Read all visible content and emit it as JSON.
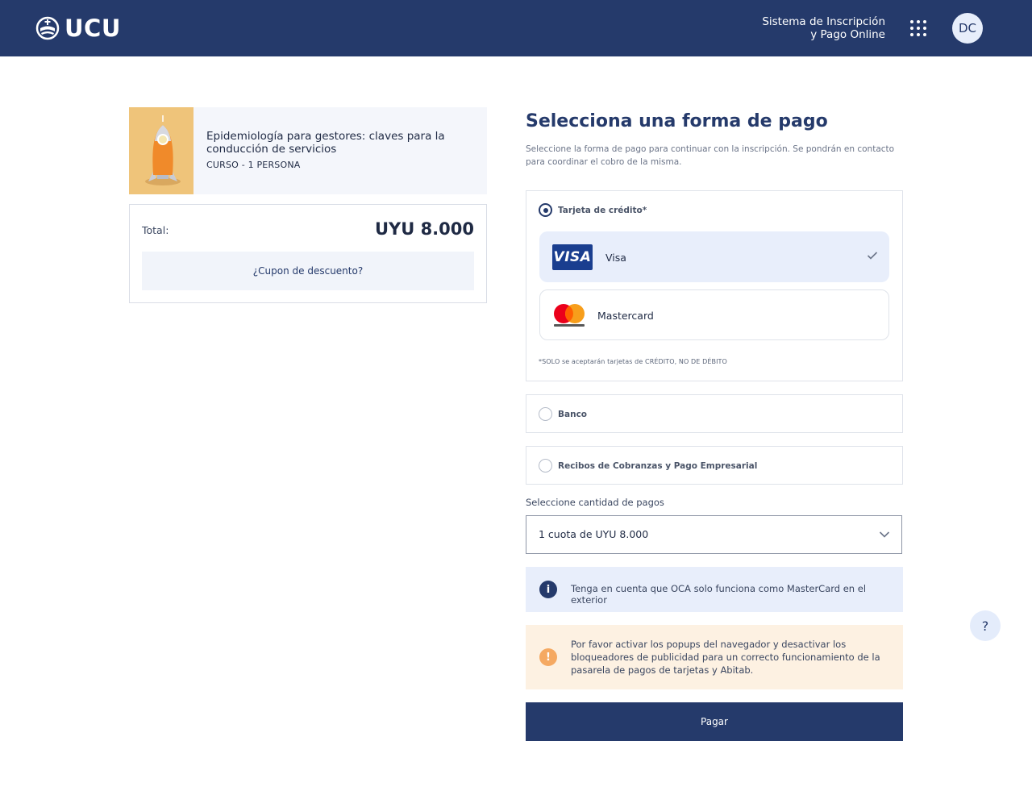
{
  "header": {
    "logo_text": "UCU",
    "system_title_line1": "Sistema de Inscripción",
    "system_title_line2": "y Pago Online",
    "apps_icon": "grid-icon",
    "avatar_initials": "DC"
  },
  "course": {
    "title": "Epidemiología para gestores: claves para la conducción de servicios",
    "meta": "CURSO - 1 PERSONA",
    "thumbnail_icon": "rocket-illustration"
  },
  "summary": {
    "total_label": "Total:",
    "total_amount": "UYU 8.000",
    "coupon_label": "¿Cupon de descuento?"
  },
  "payment": {
    "title": "Selecciona una forma de pago",
    "description": "Seleccione la forma de pago para continuar con la inscripción. Se pondrán en contacto para coordinar el cobro de la misma.",
    "methods": [
      {
        "label": "Tarjeta de crédito*",
        "selected": true
      },
      {
        "label": "Banco",
        "selected": false
      },
      {
        "label": "Recibos de Cobranzas y Pago Empresarial",
        "selected": false
      }
    ],
    "cards": [
      {
        "name": "Visa",
        "logo_text": "VISA",
        "selected": true
      },
      {
        "name": "Mastercard",
        "logo_text": "mastercard",
        "selected": false
      }
    ],
    "card_note": "*SOLO se aceptarán tarjetas de CRÉDITO, NO DE DÉBITO",
    "installments_label": "Seleccione cantidad de pagos",
    "installments_value": "1 cuota de UYU 8.000",
    "info_text": "Tenga en cuenta que OCA solo funciona como MasterCard en el exterior",
    "warning_text": "Por favor activar los popups del navegador y desactivar los bloqueadores de publicidad para un correcto funcionamiento de la pasarela de pagos de tarjetas y Abitab.",
    "pay_button": "Pagar"
  },
  "help": {
    "label": "?"
  },
  "colors": {
    "brand_navy": "#253a6b",
    "info_bg": "#e8eefb",
    "warning_bg": "#fdf1e2",
    "warning_accent": "#f5a962"
  }
}
